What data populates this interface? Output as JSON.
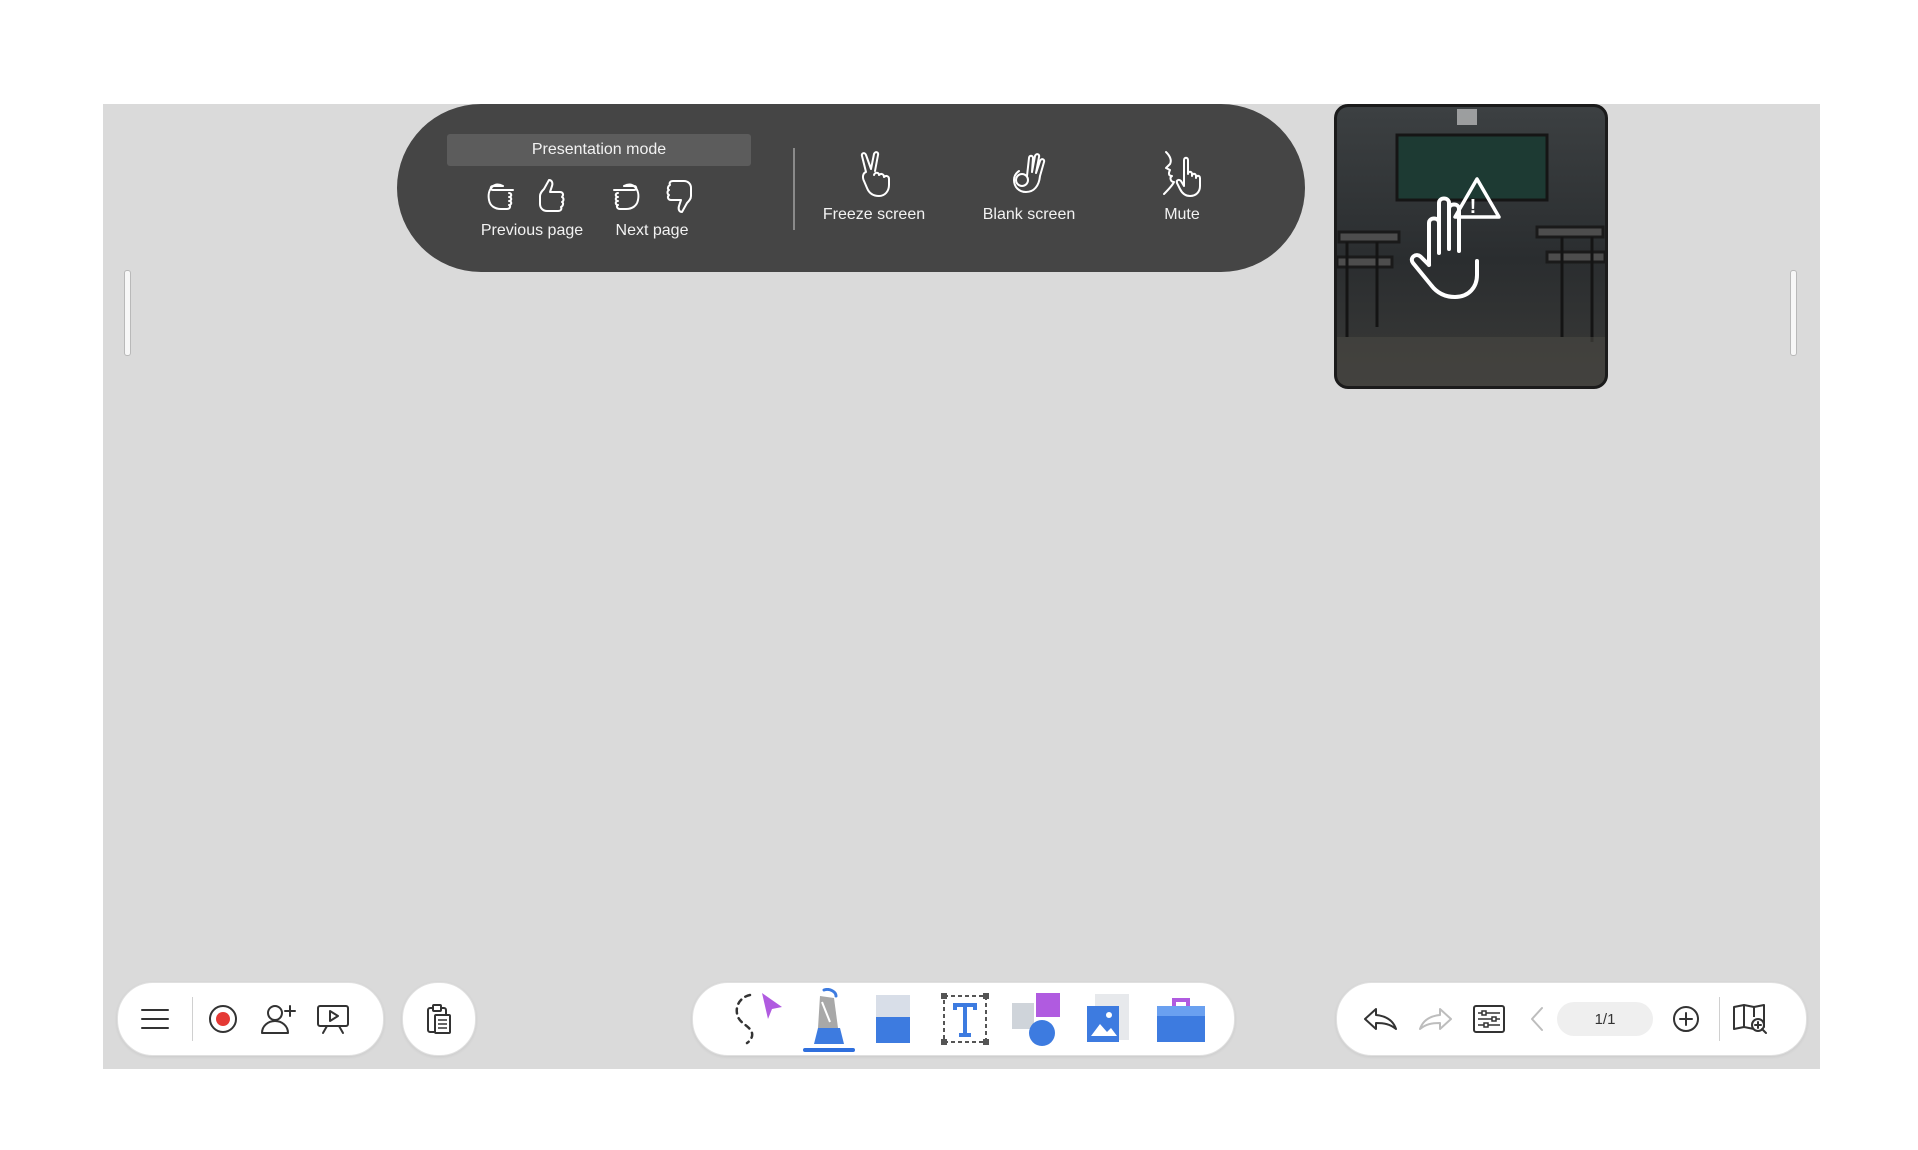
{
  "gesture_panel": {
    "header": "Presentation mode",
    "previous_label": "Previous page",
    "next_label": "Next page",
    "freeze_label": "Freeze screen",
    "blank_label": "Blank screen",
    "mute_label": "Mute"
  },
  "toolbar_left": {
    "icons": [
      "menu-icon",
      "record-icon",
      "add-user-icon",
      "present-icon"
    ]
  },
  "toolbar_clip": {
    "icons": [
      "clipboard-icon"
    ]
  },
  "toolbar_center": {
    "icons": [
      "lasso-select-icon",
      "pen-icon",
      "eraser-icon",
      "text-icon",
      "shapes-icon",
      "image-icon",
      "toolbox-icon"
    ],
    "active": "pen-icon"
  },
  "toolbar_right": {
    "icons": [
      "undo-icon",
      "redo-icon",
      "settings-icon",
      "prev-page-icon",
      "add-page-icon",
      "page-overview-icon"
    ],
    "page_indicator": "1/1"
  },
  "colors": {
    "canvas": "#dadada",
    "panel": "#454545",
    "record": "#e53935",
    "accent_blue": "#2f6fdd",
    "accent_purple": "#b05be0"
  }
}
